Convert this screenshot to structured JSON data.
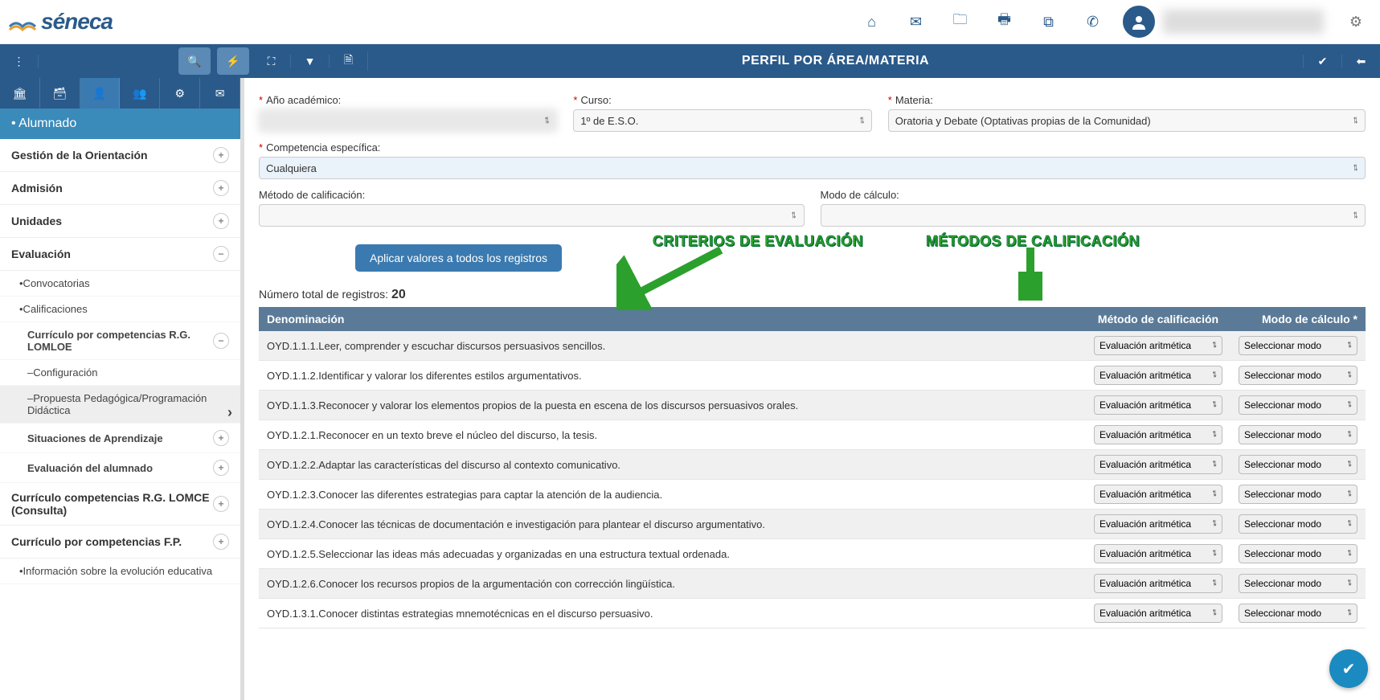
{
  "brand": "séneca",
  "toolbar": {
    "title": "PERFIL POR ÁREA/MATERIA"
  },
  "sidebar": {
    "header": "• Alumnado",
    "items": [
      {
        "label": "Gestión de la Orientación",
        "expand": "+"
      },
      {
        "label": "Admisión",
        "expand": "+"
      },
      {
        "label": "Unidades",
        "expand": "+"
      },
      {
        "label": "Evaluación",
        "expand": "−"
      }
    ],
    "eval_children": [
      {
        "label": "•Convocatorias"
      },
      {
        "label": "•Calificaciones"
      }
    ],
    "curr_lomloe": {
      "label": "Currículo por competencias R.G. LOMLOE",
      "expand": "−"
    },
    "lomloe_children": [
      {
        "label": "–Configuración"
      },
      {
        "label": "–Propuesta Pedagógica/Programación Didáctica",
        "active": true
      },
      {
        "label": "Situaciones de Aprendizaje",
        "expand": "+"
      },
      {
        "label": "Evaluación del alumnado",
        "expand": "+"
      }
    ],
    "curr_lomce": {
      "label": "Currículo competencias R.G. LOMCE (Consulta)",
      "expand": "+"
    },
    "curr_fp": {
      "label": "Currículo por competencias F.P.",
      "expand": "+"
    },
    "info": {
      "label": "•Información sobre la evolución educativa"
    }
  },
  "filters": {
    "ano_label": "Año académico:",
    "ano_value": "",
    "curso_label": "Curso:",
    "curso_value": "1º de E.S.O.",
    "materia_label": "Materia:",
    "materia_value": "Oratoria y Debate (Optativas propias de la Comunidad)",
    "comp_label": "Competencia específica:",
    "comp_value": "Cualquiera",
    "metodo_label": "Método de calificación:",
    "metodo_value": "",
    "modo_label": "Modo de cálculo:",
    "modo_value": "",
    "apply_btn": "Aplicar valores a todos los registros"
  },
  "annotations": {
    "criterios": "CRITERIOS DE EVALUACIÓN",
    "metodos": "MÉTODOS DE CALIFICACIÓN"
  },
  "records": {
    "label": "Número total de registros: ",
    "count": "20"
  },
  "table": {
    "headers": [
      "Denominación",
      "Método de calificación",
      "Modo de cálculo *"
    ],
    "metodo_option": "Evaluación aritmética",
    "modo_option": "Seleccionar modo",
    "rows": [
      "OYD.1.1.1.Leer, comprender y escuchar discursos persuasivos sencillos.",
      "OYD.1.1.2.Identificar y valorar los diferentes estilos argumentativos.",
      "OYD.1.1.3.Reconocer y valorar los elementos propios de la puesta en escena de los discursos persuasivos orales.",
      "OYD.1.2.1.Reconocer en un texto breve el núcleo del discurso, la tesis.",
      "OYD.1.2.2.Adaptar las características del discurso al contexto comunicativo.",
      "OYD.1.2.3.Conocer las diferentes estrategias para captar la atención de la audiencia.",
      "OYD.1.2.4.Conocer las técnicas de documentación e investigación para plantear el discurso argumentativo.",
      "OYD.1.2.5.Seleccionar las ideas más adecuadas y organizadas en una estructura textual ordenada.",
      "OYD.1.2.6.Conocer los recursos propios de la argumentación con corrección lingüística.",
      "OYD.1.3.1.Conocer distintas estrategias mnemotécnicas en el discurso persuasivo."
    ]
  }
}
